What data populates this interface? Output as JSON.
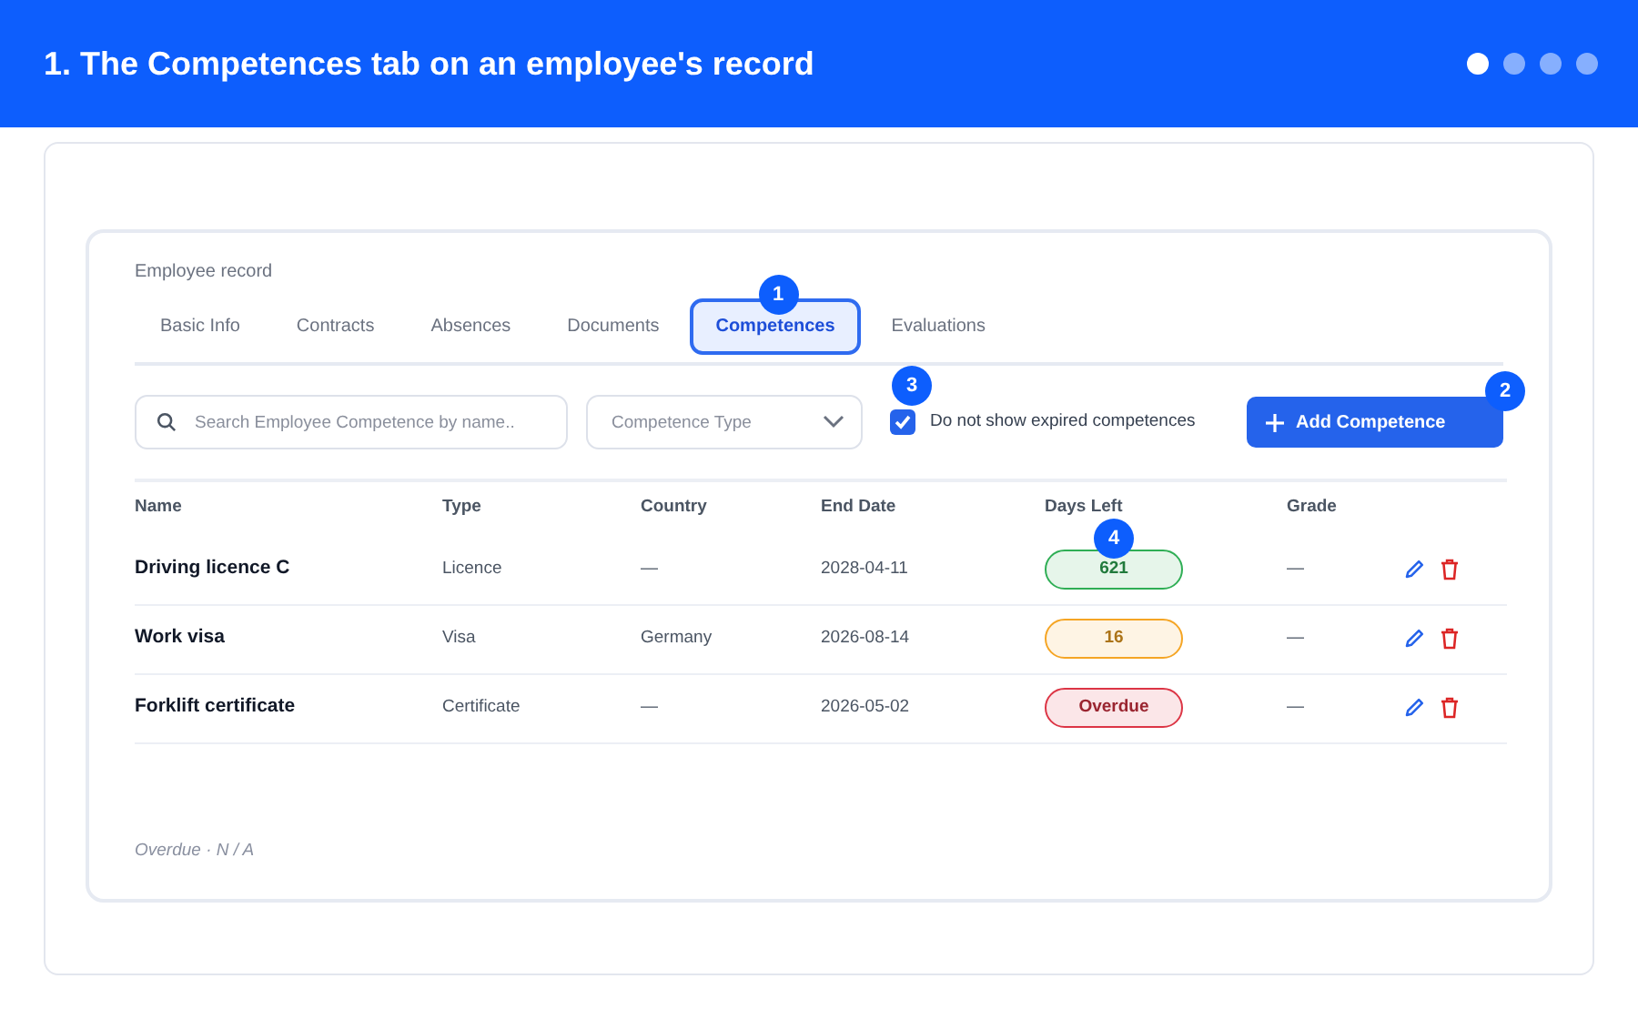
{
  "header": {
    "title": "1. The Competences tab on an employee's record",
    "steps": [
      {
        "selected": true
      },
      {
        "selected": false
      },
      {
        "selected": false
      },
      {
        "selected": false
      }
    ]
  },
  "record_label": "Employee record",
  "tabs": [
    {
      "label": "Basic Info",
      "selected": false
    },
    {
      "label": "Contracts",
      "selected": false
    },
    {
      "label": "Absences",
      "selected": false
    },
    {
      "label": "Documents",
      "selected": false
    },
    {
      "label": "Competences",
      "selected": true,
      "callout": "1"
    },
    {
      "label": "Evaluations",
      "selected": false
    }
  ],
  "toolbar": {
    "search": {
      "placeholder": "Search Employee Competence by name.."
    },
    "type_select": {
      "placeholder": "Competence Type"
    },
    "expired_filter": {
      "label": "Do not show expired competences",
      "checked": true,
      "callout": "3"
    },
    "add_button": {
      "label": "Add Competence",
      "callout": "2"
    }
  },
  "table": {
    "columns": [
      "Name",
      "Type",
      "Country",
      "End Date",
      "Days Left",
      "Grade"
    ],
    "rows": [
      {
        "name": "Driving licence C",
        "type": "Licence",
        "country": "—",
        "end_date": "2028-04-11",
        "days_left": {
          "text": "621",
          "color": "#2fae55",
          "callout": "4"
        },
        "grade": "—"
      },
      {
        "name": "Work visa",
        "type": "Visa",
        "country": "Germany",
        "end_date": "2026-08-14",
        "days_left": {
          "text": "16",
          "color": "#f5a524"
        },
        "grade": "—"
      },
      {
        "name": "Forklift certificate",
        "type": "Certificate",
        "country": "—",
        "end_date": "2026-05-02",
        "days_left": {
          "text": "Overdue",
          "color": "#dc3545"
        },
        "grade": "—"
      }
    ]
  },
  "footer_note": "Overdue · N / A"
}
